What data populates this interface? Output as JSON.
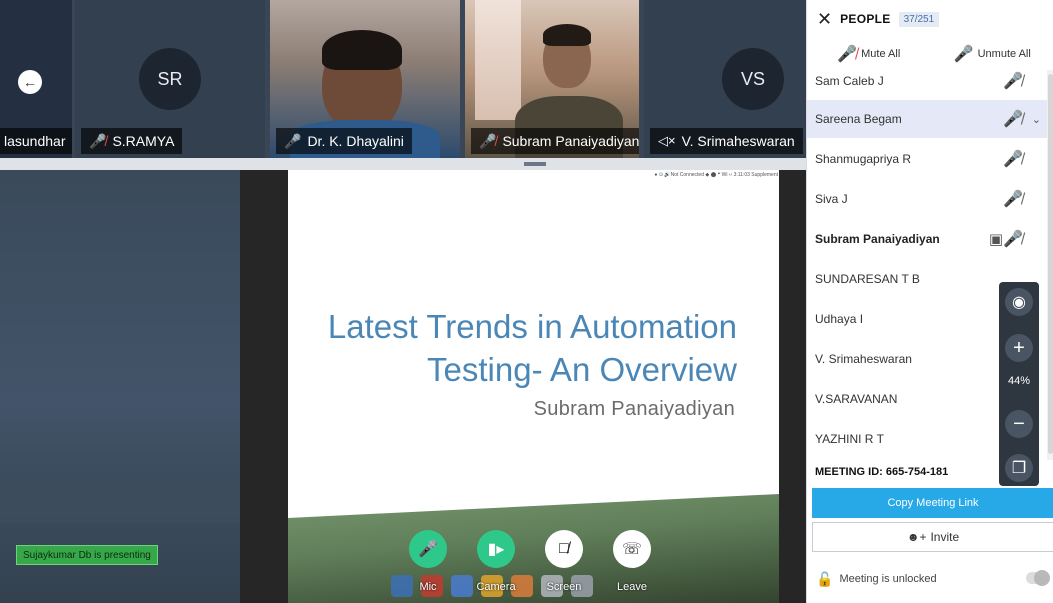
{
  "strip": {
    "tiles": [
      {
        "name": "lasundhar",
        "mic": "muted",
        "avatar": ""
      },
      {
        "name": "S.RAMYA",
        "mic": "muted",
        "avatar": "SR"
      },
      {
        "name": "Dr. K. Dhayalini",
        "mic": "on",
        "avatar": ""
      },
      {
        "name": "Subram Panaiyadiyan",
        "mic": "muted",
        "avatar": ""
      },
      {
        "name": "V. Srimaheswaran",
        "mic": "speaker-muted",
        "avatar": "VS"
      }
    ],
    "back_icon": "arrow-left-icon"
  },
  "stage": {
    "presenting_text": "Sujaykumar Db is presenting",
    "slide": {
      "title_line1": "Latest Trends in Automation",
      "title_line2": "Testing- An Overview",
      "author": "Subram Panaiyadiyan",
      "statusbar": "● ⊙ 🔊Not Connected ◆ ⬤ ❝ Wi ‹› 3:11:03 Supplement"
    }
  },
  "controls": {
    "mic_label": "Mic",
    "camera_label": "Camera",
    "screen_label": "Screen",
    "leave_label": "Leave"
  },
  "panel": {
    "title": "PEOPLE",
    "count": "37/251",
    "mute_all": "Mute All",
    "unmute_all": "Unmute All",
    "people": [
      {
        "name": "Sam Caleb J",
        "bold": false,
        "highlight": false,
        "mic": "muted",
        "screen": false
      },
      {
        "name": "Sareena Begam",
        "bold": false,
        "highlight": true,
        "mic": "muted",
        "screen": false
      },
      {
        "name": "Shanmugapriya R",
        "bold": false,
        "highlight": false,
        "mic": "muted",
        "screen": false
      },
      {
        "name": "Siva J",
        "bold": false,
        "highlight": false,
        "mic": "muted",
        "screen": false
      },
      {
        "name": "Subram Panaiyadiyan",
        "bold": true,
        "highlight": false,
        "mic": "muted",
        "screen": true
      },
      {
        "name": "SUNDARESAN T B",
        "bold": false,
        "highlight": false,
        "mic": "muted",
        "screen": false
      },
      {
        "name": "Udhaya I",
        "bold": false,
        "highlight": false,
        "mic": "muted",
        "screen": false
      },
      {
        "name": "V. Srimaheswaran",
        "bold": false,
        "highlight": false,
        "mic": "muted",
        "screen": false
      },
      {
        "name": "V.SARAVANAN",
        "bold": false,
        "highlight": false,
        "mic": "muted",
        "screen": false
      },
      {
        "name": "YAZHINI R T",
        "bold": false,
        "highlight": false,
        "mic": "muted",
        "screen": false
      }
    ],
    "meeting_id": "MEETING ID:  665-754-181",
    "copy_link": "Copy Meeting Link",
    "invite": "Invite",
    "lock_status": "Meeting is unlocked"
  },
  "zoom": {
    "level": "44%"
  },
  "colors": {
    "accent": "#27a9e8",
    "mic_on": "#2ec98a",
    "mic_muted": "#e84c4c",
    "slide_title": "#4a86b6",
    "presenting_badge": "#37a84a"
  }
}
